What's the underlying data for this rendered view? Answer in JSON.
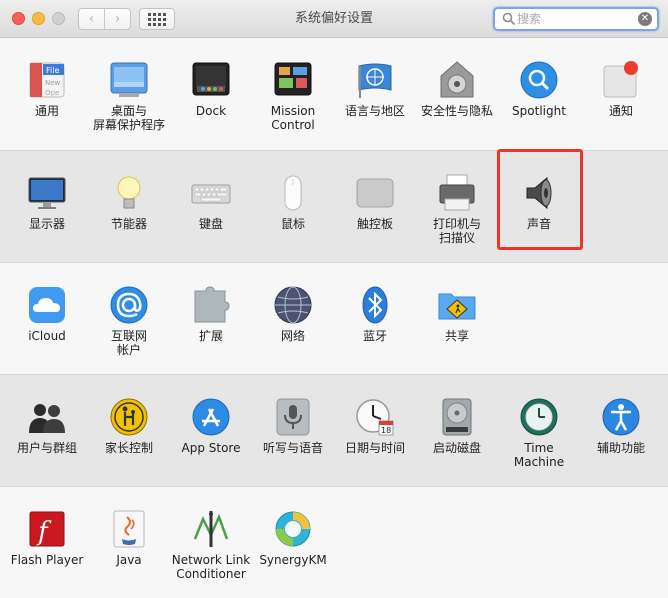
{
  "window": {
    "title": "系统偏好设置"
  },
  "toolbar": {
    "back_glyph": "‹",
    "forward_glyph": "›",
    "search_placeholder": "搜索",
    "search_value": "",
    "clear_glyph": "✕"
  },
  "sections": [
    {
      "items": [
        {
          "label": "通用",
          "icon": "general-icon"
        },
        {
          "label": "桌面与\n屏幕保护程序",
          "icon": "desktop-screensaver-icon"
        },
        {
          "label": "Dock",
          "icon": "dock-icon"
        },
        {
          "label": "Mission\nControl",
          "icon": "mission-control-icon"
        },
        {
          "label": "语言与地区",
          "icon": "language-region-icon"
        },
        {
          "label": "安全性与隐私",
          "icon": "security-privacy-icon"
        },
        {
          "label": "Spotlight",
          "icon": "spotlight-icon"
        },
        {
          "label": "通知",
          "icon": "notifications-icon"
        }
      ]
    },
    {
      "items": [
        {
          "label": "显示器",
          "icon": "displays-icon"
        },
        {
          "label": "节能器",
          "icon": "energy-saver-icon"
        },
        {
          "label": "键盘",
          "icon": "keyboard-icon"
        },
        {
          "label": "鼠标",
          "icon": "mouse-icon"
        },
        {
          "label": "触控板",
          "icon": "trackpad-icon"
        },
        {
          "label": "打印机与\n扫描仪",
          "icon": "printers-scanners-icon"
        },
        {
          "label": "声音",
          "icon": "sound-icon"
        }
      ]
    },
    {
      "items": [
        {
          "label": "iCloud",
          "icon": "icloud-icon"
        },
        {
          "label": "互联网\n帐户",
          "icon": "internet-accounts-icon"
        },
        {
          "label": "扩展",
          "icon": "extensions-icon"
        },
        {
          "label": "网络",
          "icon": "network-icon"
        },
        {
          "label": "蓝牙",
          "icon": "bluetooth-icon"
        },
        {
          "label": "共享",
          "icon": "sharing-icon"
        }
      ]
    },
    {
      "items": [
        {
          "label": "用户与群组",
          "icon": "users-groups-icon"
        },
        {
          "label": "家长控制",
          "icon": "parental-controls-icon"
        },
        {
          "label": "App Store",
          "icon": "app-store-icon"
        },
        {
          "label": "听写与语音",
          "icon": "dictation-speech-icon"
        },
        {
          "label": "日期与时间",
          "icon": "date-time-icon"
        },
        {
          "label": "启动磁盘",
          "icon": "startup-disk-icon"
        },
        {
          "label": "Time Machine",
          "icon": "time-machine-icon"
        },
        {
          "label": "辅助功能",
          "icon": "accessibility-icon"
        }
      ]
    },
    {
      "items": [
        {
          "label": "Flash Player",
          "icon": "flash-player-icon"
        },
        {
          "label": "Java",
          "icon": "java-icon"
        },
        {
          "label": "Network Link\nConditioner",
          "icon": "network-link-conditioner-icon"
        },
        {
          "label": "SynergyKM",
          "icon": "synergykm-icon"
        }
      ]
    }
  ],
  "icon_texts": {
    "general_file": "File",
    "general_new": "New",
    "general_ope": "Ope",
    "calendar_day": "18",
    "flash_f": "f"
  },
  "highlight_color": "#e8372a",
  "accent_color": "#7aa5e8"
}
